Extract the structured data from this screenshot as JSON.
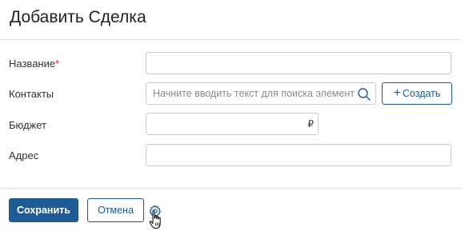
{
  "dialog": {
    "title": "Добавить Сделка"
  },
  "form": {
    "name": {
      "label": "Название",
      "required_mark": "*",
      "value": ""
    },
    "contacts": {
      "label": "Контакты",
      "value": "",
      "placeholder": "Начните вводить текст для поиска элемента",
      "search_icon": "search-icon",
      "create_plus": "+",
      "create_label": "Создать"
    },
    "budget": {
      "label": "Бюджет",
      "value": "",
      "currency": "₽"
    },
    "address": {
      "label": "Адрес",
      "value": ""
    }
  },
  "footer": {
    "save_label": "Сохранить",
    "cancel_label": "Отмена",
    "settings_icon": "gear-icon"
  },
  "colors": {
    "primary": "#1f5c95",
    "required": "#d0231f",
    "border": "#c9c9c9"
  }
}
